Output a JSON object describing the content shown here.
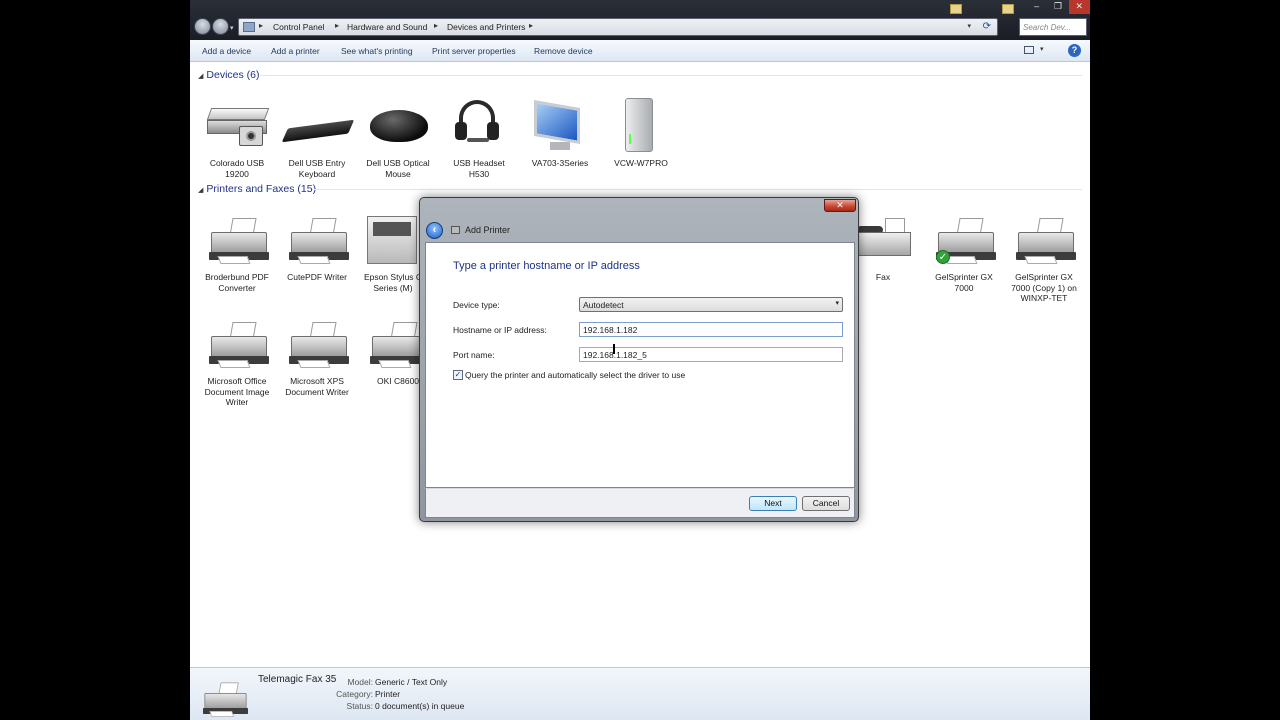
{
  "address_bar": {
    "breadcrumbs": [
      "Control Panel",
      "Hardware and Sound",
      "Devices and Printers"
    ],
    "search_placeholder": "Search Dev..."
  },
  "command_bar": {
    "add_device": "Add a device",
    "add_printer": "Add a printer",
    "see_printing": "See what's printing",
    "print_server_properties": "Print server properties",
    "remove_device": "Remove device"
  },
  "devices": {
    "header": "Devices (6)",
    "items": [
      {
        "label": "Colorado USB 19200",
        "icon": "scanner-icon"
      },
      {
        "label": "Dell USB Entry Keyboard",
        "icon": "keyboard-icon"
      },
      {
        "label": "Dell USB Optical Mouse",
        "icon": "mouse-icon"
      },
      {
        "label": "USB Headset H530",
        "icon": "headset-icon"
      },
      {
        "label": "VA703-3Series",
        "icon": "monitor-icon"
      },
      {
        "label": "VCW-W7PRO",
        "icon": "computer-tower-icon"
      }
    ]
  },
  "printers": {
    "header": "Printers and Faxes (15)",
    "items": [
      {
        "label": "Broderbund PDF Converter",
        "icon": "printer-icon"
      },
      {
        "label": "CutePDF Writer",
        "icon": "printer-icon"
      },
      {
        "label": "Epson Stylus C Series (M)",
        "icon": "inkjet-printer-icon"
      },
      {
        "label": "Fax",
        "icon": "fax-icon"
      },
      {
        "label": "GelSprinter GX 7000",
        "icon": "printer-icon",
        "default": true
      },
      {
        "label": "GelSprinter GX 7000 (Copy 1) on WINXP-TET",
        "icon": "printer-icon"
      },
      {
        "label": "Microsoft Office Document Image Writer",
        "icon": "printer-icon"
      },
      {
        "label": "Microsoft XPS Document Writer",
        "icon": "printer-icon"
      },
      {
        "label": "OKI C8600",
        "icon": "printer-icon"
      }
    ]
  },
  "details": {
    "name": "Telemagic Fax 35",
    "model_label": "Model:",
    "model": "Generic / Text Only",
    "category_label": "Category:",
    "category": "Printer",
    "status_label": "Status:",
    "status": "0 document(s) in queue"
  },
  "dialog": {
    "title": "Add Printer",
    "heading": "Type a printer hostname or IP address",
    "device_type_label": "Device type:",
    "device_type_value": "Autodetect",
    "hostname_label": "Hostname or IP address:",
    "hostname_value": "192.168.1.182",
    "port_label": "Port name:",
    "port_value": "192.168.1.182_5",
    "query_label": "Query the printer and automatically select the driver to use",
    "query_checked": true,
    "next": "Next",
    "cancel": "Cancel"
  }
}
